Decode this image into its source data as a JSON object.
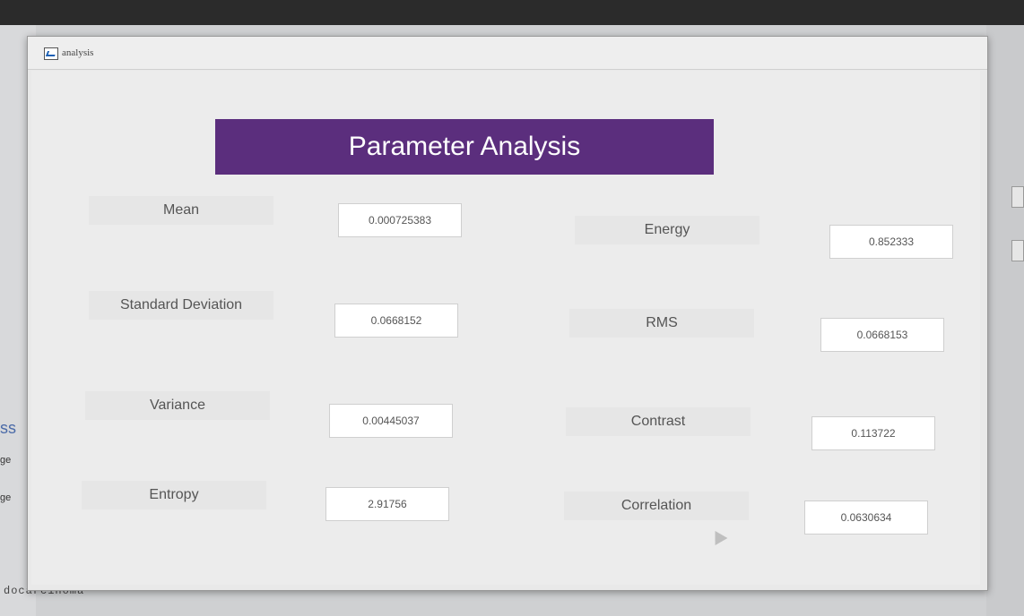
{
  "window": {
    "title": "analysis"
  },
  "header": {
    "title": "Parameter Analysis"
  },
  "left_params": [
    {
      "label": "Mean",
      "value": "0.000725383"
    },
    {
      "label": "Standard Deviation",
      "value": "0.0668152"
    },
    {
      "label": "Variance",
      "value": "0.00445037"
    },
    {
      "label": "Entropy",
      "value": "2.91756"
    }
  ],
  "right_params": [
    {
      "label": "Energy",
      "value": "0.852333"
    },
    {
      "label": "RMS",
      "value": "0.0668153"
    },
    {
      "label": "Contrast",
      "value": "0.113722"
    },
    {
      "label": "Correlation",
      "value": "0.0630634"
    }
  ],
  "background": {
    "side_text": "ss",
    "side_small_1": "ge",
    "side_small_2": "ge",
    "bottom_text": "docarcinoma"
  },
  "colors": {
    "banner": "#5b2e7d",
    "window_bg": "#ececec"
  }
}
